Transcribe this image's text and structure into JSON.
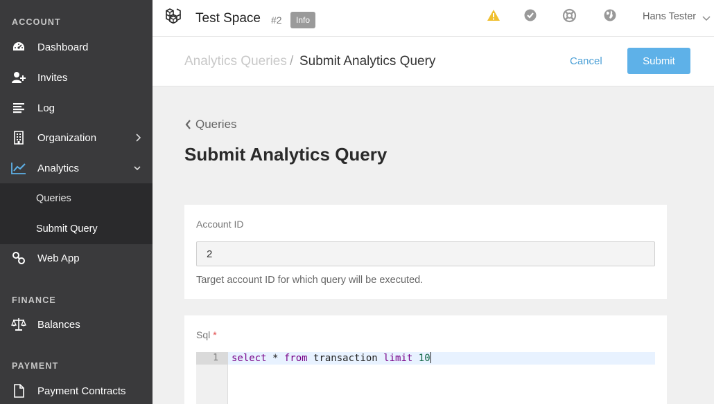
{
  "sidebar": {
    "sections": {
      "account": "ACCOUNT",
      "finance": "FINANCE",
      "payment": "PAYMENT"
    },
    "items": {
      "dashboard": "Dashboard",
      "invites": "Invites",
      "log": "Log",
      "organization": "Organization",
      "analytics": "Analytics",
      "queries": "Queries",
      "submit_query": "Submit Query",
      "web_app": "Web App",
      "balances": "Balances",
      "payment_contracts": "Payment Contracts"
    },
    "accent_color": "#5eb1e8"
  },
  "header": {
    "space_name": "Test Space",
    "space_number": "#2",
    "info_badge": "Info",
    "user_name": "Hans Tester",
    "icons": [
      "warning-icon",
      "check-circle-icon",
      "support-icon",
      "globe-icon"
    ],
    "warning_color": "#f0c030"
  },
  "subheader": {
    "breadcrumb_parent": "Analytics Queries",
    "breadcrumb_separator": "/",
    "breadcrumb_current": "Submit Analytics Query",
    "cancel_label": "Cancel",
    "submit_label": "Submit"
  },
  "main": {
    "back_link": "Queries",
    "title": "Submit Analytics Query",
    "account_field": {
      "label": "Account ID",
      "value": "2",
      "help": "Target account ID for which query will be executed."
    },
    "sql_field": {
      "label": "Sql",
      "required_mark": "*",
      "line_number": "1",
      "code": {
        "select": "select",
        "star": " * ",
        "from": "from",
        "table": " transaction ",
        "limit": "limit",
        "space": " ",
        "value": "10"
      }
    }
  }
}
